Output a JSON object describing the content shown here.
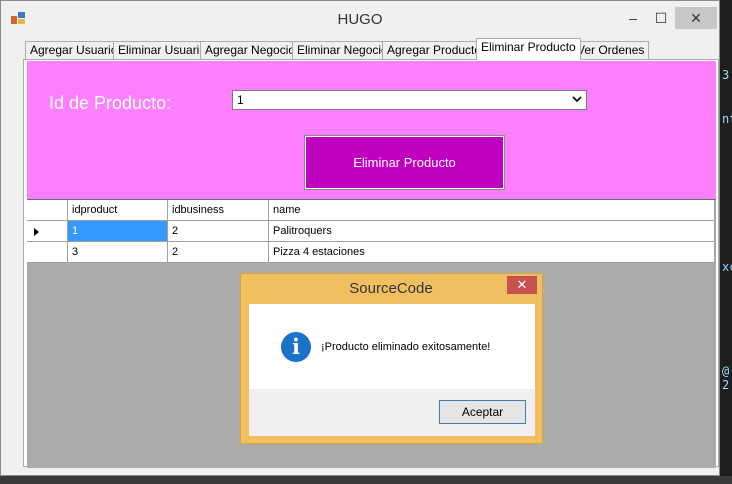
{
  "window": {
    "title": "HUGO",
    "minimize_glyph": "–",
    "maximize_glyph": "☐",
    "close_glyph": "✕",
    "icon": "app-icon"
  },
  "tabs": [
    {
      "label": "Agregar Usuario",
      "active": false
    },
    {
      "label": "Eliminar Usuario",
      "active": false
    },
    {
      "label": "Agregar Negocio",
      "active": false
    },
    {
      "label": "Eliminar Negocio",
      "active": false
    },
    {
      "label": "Agregar Producto",
      "active": false
    },
    {
      "label": "Eliminar Producto",
      "active": true
    },
    {
      "label": "Ver Ordenes",
      "active": false
    }
  ],
  "form": {
    "id_label": "Id de Producto:",
    "id_value": "1",
    "delete_button": "Eliminar Producto",
    "panel_color": "#ff80ff",
    "button_color": "#c000c0"
  },
  "grid": {
    "columns": [
      "idproduct",
      "idbusiness",
      "name"
    ],
    "rows": [
      {
        "idproduct": "1",
        "idbusiness": "2",
        "name": "Palitroquers",
        "current": true
      },
      {
        "idproduct": "3",
        "idbusiness": "2",
        "name": "Pizza 4 estaciones",
        "current": false
      }
    ],
    "selection_color": "#3399ff"
  },
  "dialog": {
    "title": "SourceCode",
    "message": "¡Producto eliminado exitosamente!",
    "ok_button": "Aceptar",
    "close_glyph": "✕",
    "icon": "info-icon",
    "icon_glyph": "i"
  },
  "editor_glyphs": [
    "3",
    "nt",
    "xc",
    "@ 2"
  ]
}
